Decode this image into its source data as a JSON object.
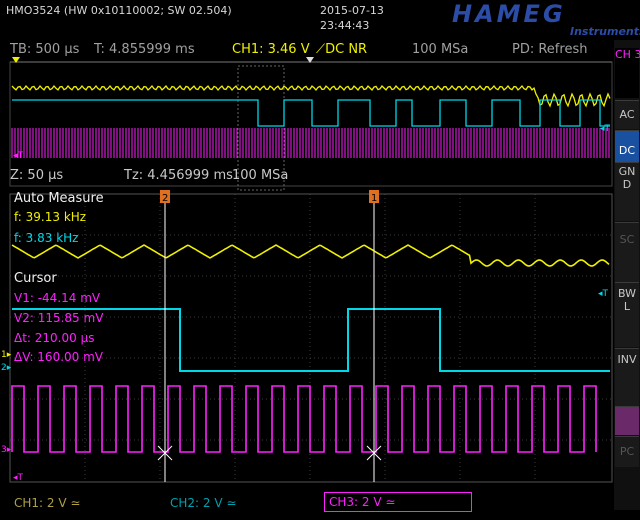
{
  "header": {
    "device_info": "HMO3524 (HW 0x10110002; SW 02.504)",
    "date": "2015-07-13",
    "time": "23:44:43",
    "brand": "HAMEG",
    "brand_sub": "Instruments"
  },
  "status": {
    "timebase": "TB: 500 µs",
    "trigger_time": "T: 4.855999 ms",
    "trigger": "CH1: 3.46 V",
    "trigger_slope_mode": "DC NR",
    "sample_rate": "100 MSa",
    "pd": "PD: Refresh"
  },
  "zoom": {
    "zoom": "Z: 50 µs",
    "tz": "Tz: 4.456999 ms",
    "sample_rate": "100 MSa"
  },
  "auto_measure": {
    "title": "Auto Measure",
    "f1": "f: 39.13 kHz",
    "f2": "f: 3.83 kHz"
  },
  "cursor": {
    "title": "Cursor",
    "v1": "V1: -44.14 mV",
    "v2": "V2: 115.85 mV",
    "dt": "Δt: 210.00 µs",
    "dv": "ΔV: 160.00 mV",
    "marker1": "1",
    "marker2": "2"
  },
  "side_menu": {
    "channel": "CH 3",
    "ac": "AC",
    "dc": "DC",
    "gnd": "GND",
    "sc": "SC",
    "bwl": "BWL",
    "inv": "INV",
    "pc": "PC"
  },
  "footer": {
    "ch1": "CH1: 2 V ≃",
    "ch2": "CH2: 2 V ≃",
    "ch3": "CH3: 2 V ≃"
  },
  "colors": {
    "ch1": "#f0f000",
    "ch2": "#00d8e8",
    "ch3": "#ff20ff",
    "brand": "#2b4da8",
    "active_button": "#1a50a0"
  }
}
